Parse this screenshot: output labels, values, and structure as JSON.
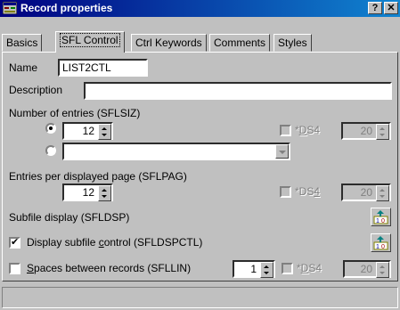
{
  "window": {
    "title": "Record properties",
    "help_btn": "?",
    "close_btn": "✕",
    "title_bg": "#000080"
  },
  "tabs": [
    {
      "label": "Basics",
      "active": false
    },
    {
      "label": "SFL Control",
      "active": true
    },
    {
      "label": "Ctrl Keywords",
      "active": false
    },
    {
      "label": "Comments",
      "active": false
    },
    {
      "label": "Styles",
      "active": false
    }
  ],
  "form": {
    "name_label": "Name",
    "name_value": "LIST2CTL",
    "description_label": "Description",
    "description_value": "",
    "entries_label": "Number of entries (SFLSIZ)",
    "entries_value": "12",
    "ds4_label": "*DS4",
    "ds4_entries_value": "20",
    "entries_dropdown_value": "",
    "per_page_label": "Entries per displayed page (SFLPAG)",
    "per_page_value": "12",
    "ds4_per_page_value": "20",
    "subfile_display_label": "Subfile display (SFLDSP)",
    "display_control_label": "Display subfile control (SFLDSPCTL)",
    "display_control_checked": true,
    "spaces_label": "Spaces between records (SFLLIN)",
    "spaces_checked": false,
    "spaces_value": "1",
    "ds4_spaces_value": "20"
  }
}
